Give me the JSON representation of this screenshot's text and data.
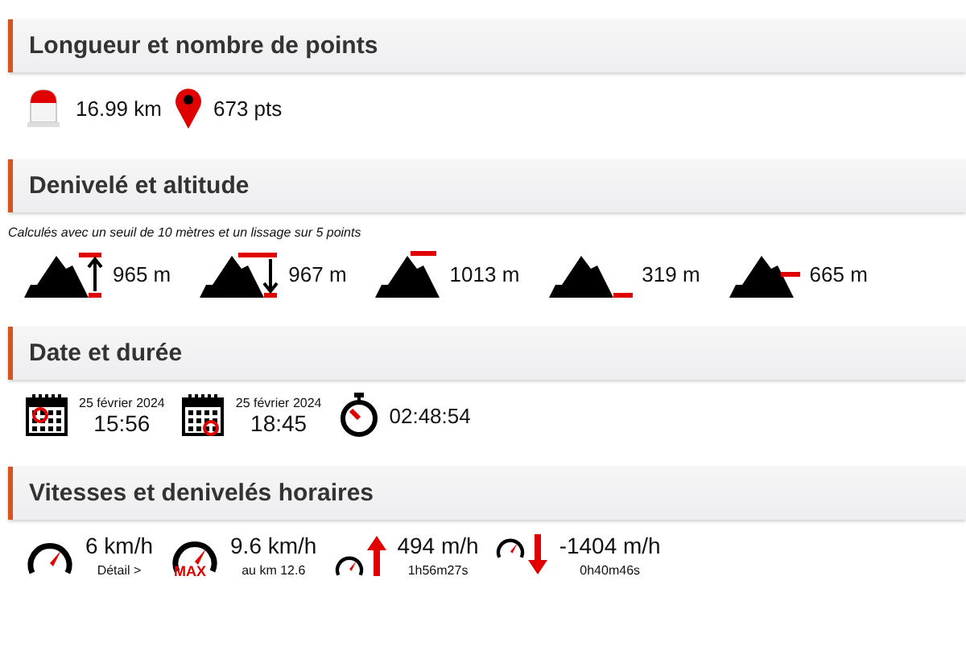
{
  "sections": [
    {
      "title": "Longueur et nombre de points",
      "kind": "length",
      "items": [
        {
          "kind": "distance",
          "value": "16.99 km"
        },
        {
          "kind": "points",
          "value": "673 pts"
        }
      ]
    },
    {
      "title": "Denivelé et altitude",
      "kind": "elevation",
      "note": "Calculés avec un seuil de 10 mètres et un lissage sur 5 points",
      "items": [
        {
          "kind": "gain",
          "value": "965 m"
        },
        {
          "kind": "loss",
          "value": "967 m"
        },
        {
          "kind": "max",
          "value": "1013 m"
        },
        {
          "kind": "min",
          "value": "319 m"
        },
        {
          "kind": "avg",
          "value": "665 m"
        }
      ]
    },
    {
      "title": "Date et durée",
      "kind": "date",
      "items": [
        {
          "kind": "start",
          "date": "25 février 2024",
          "value": "15:56"
        },
        {
          "kind": "end",
          "date": "25 février 2024",
          "value": "18:45"
        },
        {
          "kind": "duration",
          "value": "02:48:54"
        }
      ]
    },
    {
      "title": "Vitesses et denivelés horaires",
      "kind": "speed",
      "items": [
        {
          "kind": "avg",
          "value": "6 km/h",
          "sub": "Détail >"
        },
        {
          "kind": "max",
          "badge": "MAX",
          "value": "9.6 km/h",
          "sub": "au km 12.6"
        },
        {
          "kind": "up",
          "value": "494 m/h",
          "sub": "1h56m27s"
        },
        {
          "kind": "down",
          "value": "-1404 m/h",
          "sub": "0h40m46s"
        }
      ]
    }
  ]
}
